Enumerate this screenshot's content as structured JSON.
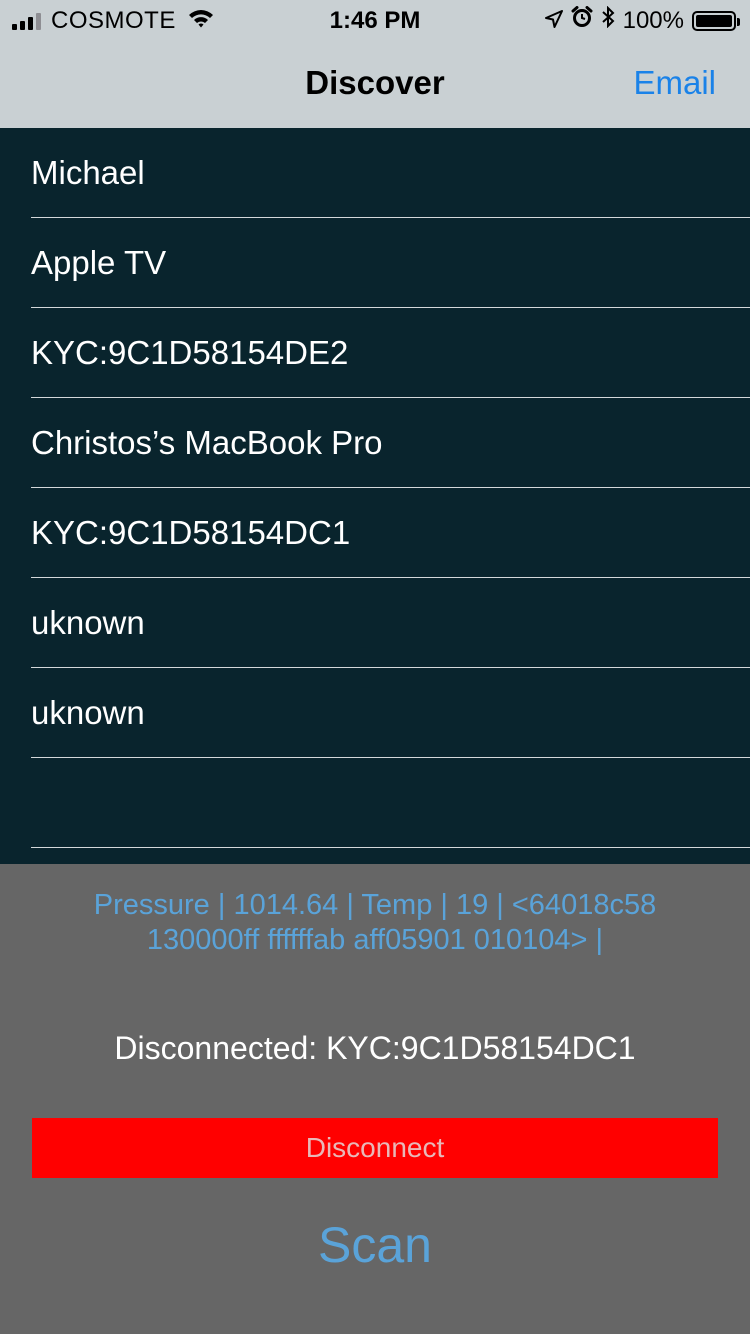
{
  "status_bar": {
    "carrier": "COSMOTE",
    "time": "1:46 PM",
    "battery": "100%",
    "icons": [
      "signal-icon",
      "wifi-icon",
      "location-arrow-icon",
      "alarm-icon",
      "bluetooth-icon",
      "battery-icon"
    ]
  },
  "nav": {
    "title": "Discover",
    "email_label": "Email"
  },
  "devices": [
    {
      "label": "Michael"
    },
    {
      "label": "Apple TV"
    },
    {
      "label": "KYC:9C1D58154DE2"
    },
    {
      "label": "Christos’s MacBook Pro"
    },
    {
      "label": "KYC:9C1D58154DC1"
    },
    {
      "label": "uknown"
    },
    {
      "label": "uknown"
    },
    {
      "label": ""
    }
  ],
  "panel": {
    "sensor_line1": "Pressure | 1014.64 | Temp | 19 | <64018c58",
    "sensor_line2": "130000ff ffffffab aff05901 010104> |",
    "connection_status": "Disconnected:  KYC:9C1D58154DC1",
    "disconnect_label": "Disconnect",
    "scan_label": "Scan"
  },
  "colors": {
    "nav_background": "#c9d0d3",
    "list_background": "#09242d",
    "panel_background": "#666666",
    "accent_blue": "#1a82e8",
    "sensor_text": "#5aa3d9",
    "disconnect_button": "#ff0000"
  }
}
